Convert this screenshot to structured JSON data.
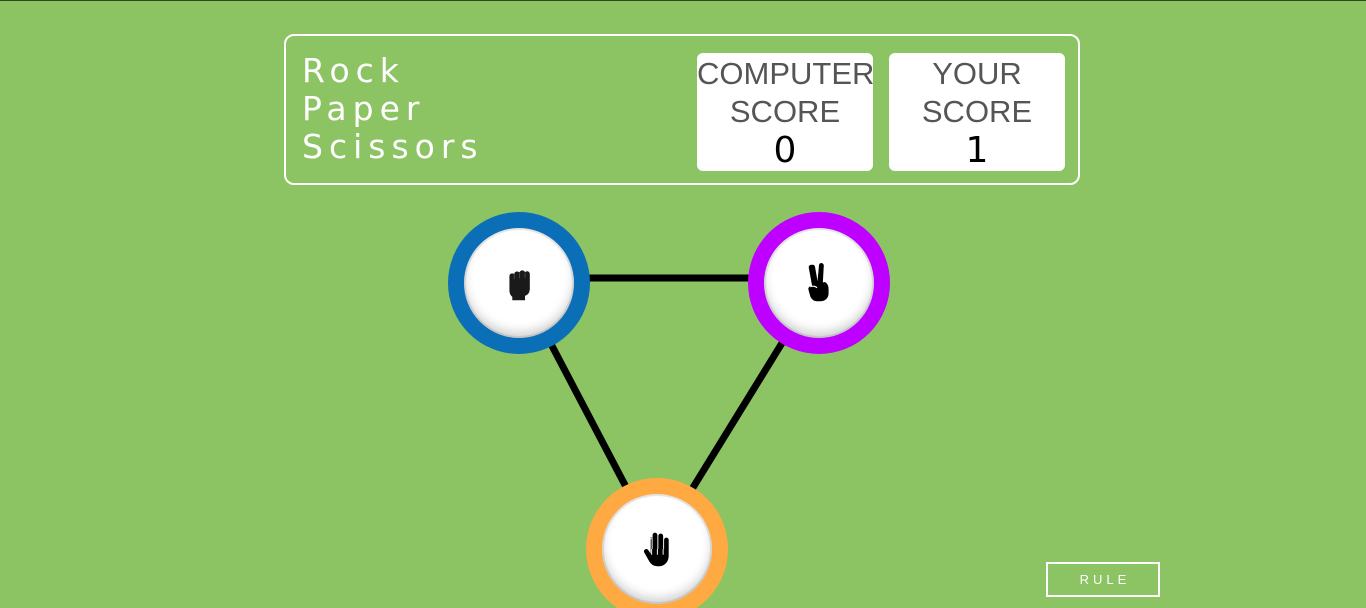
{
  "header": {
    "title_lines": [
      "Rock",
      "Paper",
      "Scissors"
    ],
    "computer_score": {
      "label_line1": "COMPUTER",
      "label_line2": "SCORE",
      "value": "0"
    },
    "your_score": {
      "label_line1": "YOUR",
      "label_line2": "SCORE",
      "value": "1"
    }
  },
  "choices": [
    {
      "name": "rock",
      "icon": "fist-icon",
      "ring_color": "#0b6fb8"
    },
    {
      "name": "scissors",
      "icon": "peace-hand-icon",
      "ring_color": "#bd00ff"
    },
    {
      "name": "paper",
      "icon": "open-hand-icon",
      "ring_color": "#ffa943"
    }
  ],
  "rule_button": {
    "label": "RULE"
  },
  "colors": {
    "background": "#8cc463",
    "connector_lines": "#000000"
  }
}
